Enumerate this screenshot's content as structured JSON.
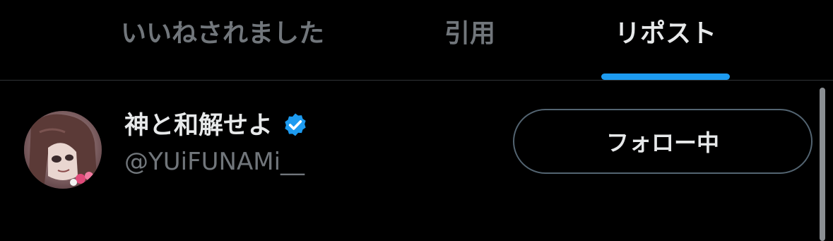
{
  "tabs": [
    {
      "label": "いいねされました",
      "active": false
    },
    {
      "label": "引用",
      "active": false
    },
    {
      "label": "リポスト",
      "active": true
    }
  ],
  "user": {
    "display_name": "神と和解せよ",
    "handle": "@YUiFUNAMi__",
    "verified": true,
    "follow_button_label": "フォロー中",
    "avatar_icon": "anime-character-avatar"
  },
  "colors": {
    "background": "#000000",
    "primary_text": "#e7e9ea",
    "secondary_text": "#71767b",
    "accent": "#1d9bf0",
    "divider": "#2f3336",
    "button_border": "#536471"
  }
}
